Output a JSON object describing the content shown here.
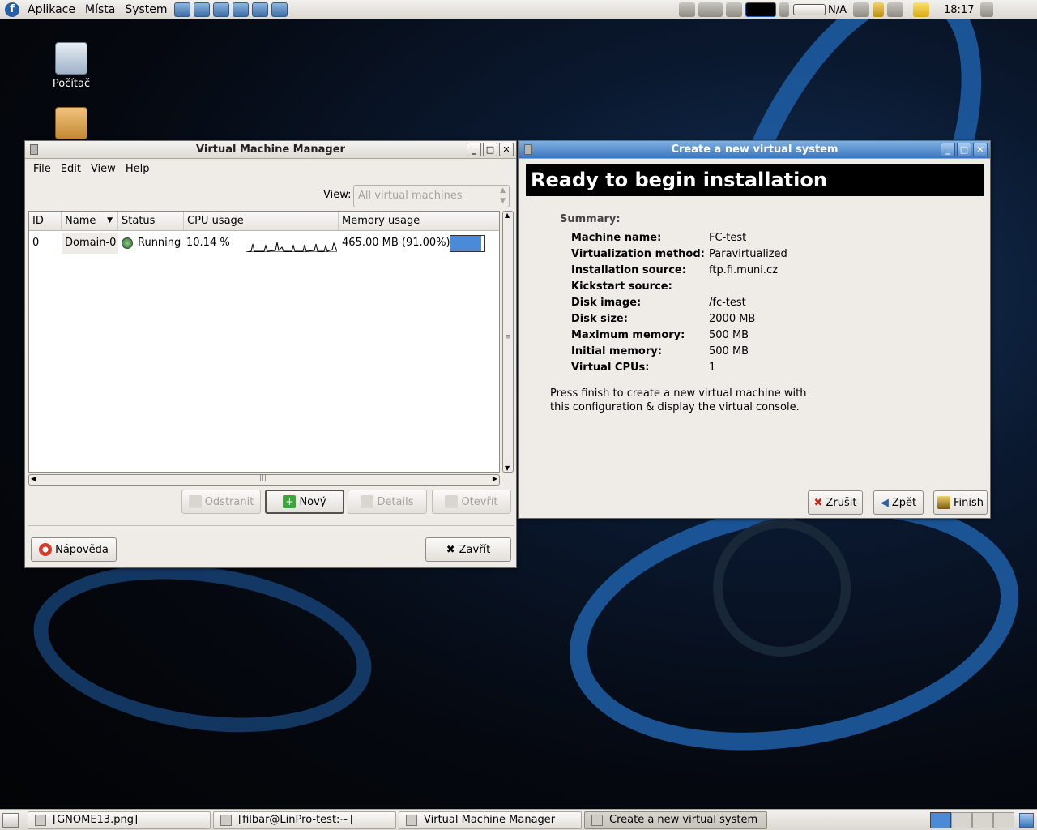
{
  "top_panel": {
    "menus": [
      "Aplikace",
      "Místa",
      "System"
    ],
    "battery_text": "N/A",
    "clock": "18:17"
  },
  "desktop": {
    "icons": [
      {
        "label": "Počítač"
      },
      {
        "label": ""
      }
    ]
  },
  "vmm": {
    "title": "Virtual Machine Manager",
    "menu": [
      "File",
      "Edit",
      "View",
      "Help"
    ],
    "view_label": "View:",
    "view_select": "All virtual machines",
    "columns": [
      "ID",
      "Name",
      "Status",
      "CPU usage",
      "Memory usage"
    ],
    "rows": [
      {
        "id": "0",
        "name": "Domain-0",
        "status": "Running",
        "cpu": "10.14 %",
        "memory": "465.00 MB (91.00%)",
        "memory_fraction": 0.91
      }
    ],
    "buttons": {
      "delete": "Odstranit",
      "new": "Nový",
      "details": "Details",
      "open": "Otevřít",
      "help": "Nápověda",
      "close": "Zavřít"
    }
  },
  "create": {
    "title": "Create a new virtual system",
    "header": "Ready to begin installation",
    "summary_label": "Summary:",
    "summary": [
      {
        "label": "Machine name:",
        "value": "FC-test"
      },
      {
        "label": "Virtualization method:",
        "value": "Paravirtualized"
      },
      {
        "label": "Installation source:",
        "value": "ftp.fi.muni.cz"
      },
      {
        "label": "Kickstart source:",
        "value": ""
      },
      {
        "label": "Disk image:",
        "value": "/fc-test"
      },
      {
        "label": "Disk size:",
        "value": "2000 MB"
      },
      {
        "label": "Maximum memory:",
        "value": "500 MB"
      },
      {
        "label": "Initial memory:",
        "value": "500 MB"
      },
      {
        "label": "Virtual CPUs:",
        "value": "1"
      }
    ],
    "note_line1": "Press finish to create a new virtual machine with",
    "note_line2": "this configuration & display the virtual console.",
    "buttons": {
      "cancel": "Zrušit",
      "back": "Zpět",
      "finish": "Finish"
    }
  },
  "taskbar": {
    "items": [
      "[GNOME13.png]",
      "[filbar@LinPro-test:~]",
      "Virtual Machine Manager",
      "Create a new virtual system"
    ]
  }
}
